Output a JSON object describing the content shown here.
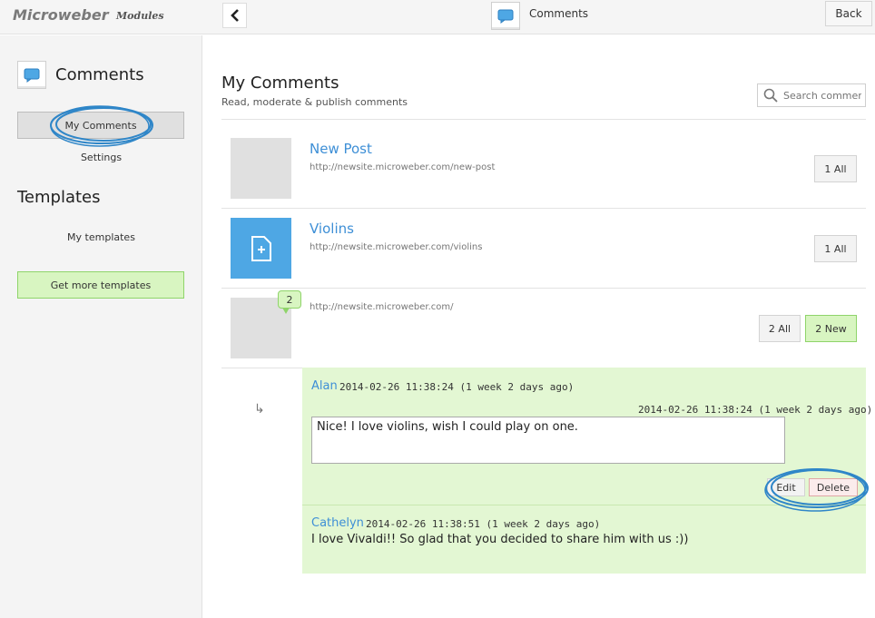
{
  "topbar": {
    "brand": "Microweber",
    "brand_sub": "Modules",
    "title": "Comments",
    "back_label": "Back"
  },
  "sidebar": {
    "title": "Comments",
    "tab_label": "My Comments",
    "settings_label": "Settings",
    "templates_heading": "Templates",
    "my_templates_label": "My templates",
    "get_more_label": "Get more templates"
  },
  "main": {
    "title": "My Comments",
    "subtitle": "Read, moderate & publish comments",
    "search_placeholder": "Search comments",
    "posts": [
      {
        "title": "New Post",
        "url": "http://newsite.microweber.com/new-post",
        "all_label": "1 All"
      },
      {
        "title": "Violins",
        "url": "http://newsite.microweber.com/violins",
        "all_label": "1 All"
      },
      {
        "title": "",
        "url": "http://newsite.microweber.com/",
        "all_label": "2 All",
        "new_label": "2 New",
        "bubble_count": "2"
      }
    ],
    "comments": [
      {
        "author": "Alan",
        "date": "2014-02-26 11:38:24 (1 week 2 days ago)",
        "edit_date": "2014-02-26 11:38:24 (1 week 2 days ago)",
        "text": "Nice! I love violins, wish I could play on one.",
        "edit_label": "Edit",
        "delete_label": "Delete"
      },
      {
        "author": "Cathelyn",
        "date": "2014-02-26 11:38:51 (1 week 2 days ago)",
        "text": "I love Vivaldi!! So glad that you decided to share him with us :))"
      }
    ]
  },
  "colors": {
    "accent_blue": "#3e8fd6",
    "green_bg": "#d8f5c1",
    "panel_green": "#e3f7d3",
    "marker_blue": "#2f86c8"
  }
}
